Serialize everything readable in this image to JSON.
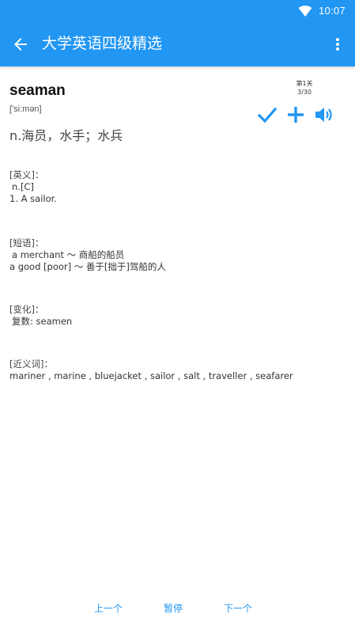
{
  "status_bar": {
    "time": "10:07",
    "icons": [
      "wifi-icon"
    ]
  },
  "app_bar": {
    "title": "大学英语四级精选",
    "icons": [
      "back-arrow-icon",
      "more-vert-icon"
    ]
  },
  "word": {
    "headword": "seaman",
    "phonetic": "['si:mən]",
    "meaning": "n.海员，水手；水兵",
    "level_label": "第1关",
    "progress": "3/30",
    "action_icons": [
      "check-icon",
      "plus-icon",
      "volume-icon"
    ]
  },
  "sections": {
    "english": {
      "heading": "[英义]：",
      "lines": [
        "n.[C]",
        "1. A sailor."
      ]
    },
    "phrases": {
      "heading": "[短语]：",
      "lines": [
        "a merchant ～ 商船的船员",
        "a good [poor] ～ 善于[拙于]驾船的人"
      ]
    },
    "inflection": {
      "heading": "[变化]：",
      "lines": [
        "复数: seamen"
      ]
    },
    "synonyms": {
      "heading": "[近义词]：",
      "lines": [
        "mariner , marine , bluejacket , sailor , salt , traveller , seafarer"
      ]
    }
  },
  "bottom_bar": {
    "prev": "上一个",
    "pause": "暂停",
    "next": "下一个"
  },
  "colors": {
    "primary": "#2196f3",
    "text": "#333333"
  }
}
